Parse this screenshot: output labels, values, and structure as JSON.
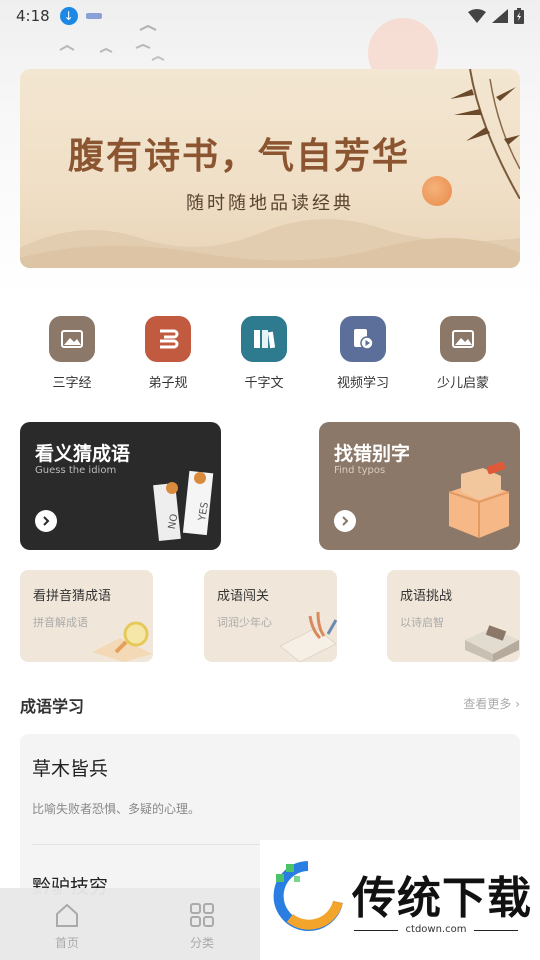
{
  "status_bar": {
    "time": "4:18"
  },
  "banner": {
    "title": "腹有诗书，气自芳华",
    "subtitle": "随时随地品读经典"
  },
  "quick_nav": [
    {
      "label": "三字经",
      "color": "#8b7868",
      "icon": "image-icon"
    },
    {
      "label": "弟子规",
      "color": "#c25a3f",
      "icon": "scroll-icon"
    },
    {
      "label": "千字文",
      "color": "#2e7a8f",
      "icon": "books-icon"
    },
    {
      "label": "视频学习",
      "color": "#5c6f9a",
      "icon": "video-icon"
    },
    {
      "label": "少儿启蒙",
      "color": "#8b7868",
      "icon": "image-icon"
    }
  ],
  "feature_cards": [
    {
      "title": "看义猜成语",
      "subtitle": "Guess the idiom",
      "bg": "#2a2a2a",
      "signs": [
        "NO",
        "YES"
      ]
    },
    {
      "title": "找错别字",
      "subtitle": "Find typos",
      "bg": "#8b7868"
    }
  ],
  "mini_cards": [
    {
      "title": "看拼音猜成语",
      "subtitle": "拼音解成语"
    },
    {
      "title": "成语闯关",
      "subtitle": "词润少年心"
    },
    {
      "title": "成语挑战",
      "subtitle": "以诗启智"
    }
  ],
  "idiom_section": {
    "title": "成语学习",
    "more": "查看更多",
    "items": [
      {
        "name": "草木皆兵",
        "desc": "比喻失败者恐惧、多疑的心理。"
      },
      {
        "name": "黔驴技穷"
      }
    ]
  },
  "tabs": [
    {
      "label": "首页",
      "icon": "home-icon"
    },
    {
      "label": "分类",
      "icon": "grid-icon"
    }
  ],
  "watermark": {
    "text": "传统下载",
    "url": "ctdown.com"
  }
}
